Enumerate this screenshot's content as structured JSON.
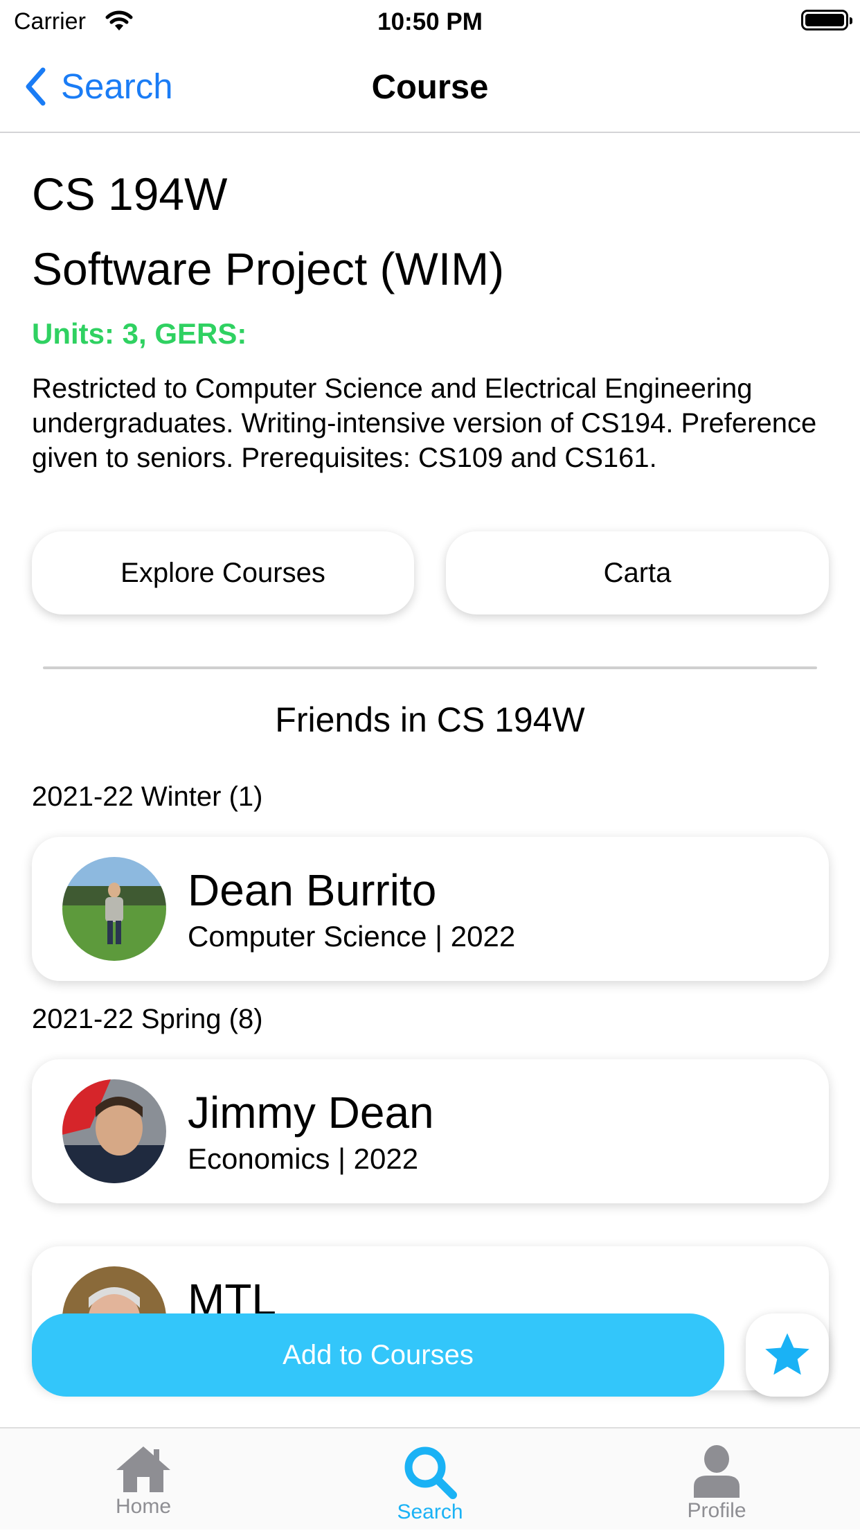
{
  "status_bar": {
    "carrier": "Carrier",
    "time": "10:50 PM"
  },
  "nav": {
    "back_label": "Search",
    "title": "Course"
  },
  "course": {
    "code": "CS 194W",
    "title": "Software Project (WIM)",
    "units_gers": "Units: 3, GERS:",
    "description": "Restricted to Computer Science and Electrical Engineering undergraduates.  Writing-intensive version of CS194. Preference given to seniors. Prerequisites: CS109 and CS161."
  },
  "buttons": {
    "explore": "Explore Courses",
    "carta": "Carta",
    "add": "Add to Courses"
  },
  "friends_heading": "Friends in CS 194W",
  "terms": [
    {
      "label": "2021-22 Winter (1)"
    },
    {
      "label": "2021-22 Spring (8)"
    }
  ],
  "friends": [
    {
      "name": "Dean Burrito",
      "subtitle": "Computer Science | 2022"
    },
    {
      "name": "Jimmy Dean",
      "subtitle": "Economics | 2022"
    },
    {
      "name": "MTL",
      "subtitle": ""
    }
  ],
  "tabs": [
    {
      "label": "Home",
      "icon": "house-icon"
    },
    {
      "label": "Search",
      "icon": "search-icon"
    },
    {
      "label": "Profile",
      "icon": "person-icon"
    }
  ],
  "colors": {
    "accent_blue": "#1a7cf5",
    "units_green": "#2fd161",
    "add_button": "#33c6fa",
    "tab_active": "#1ab2f5",
    "tab_inactive": "#8e8e93"
  }
}
